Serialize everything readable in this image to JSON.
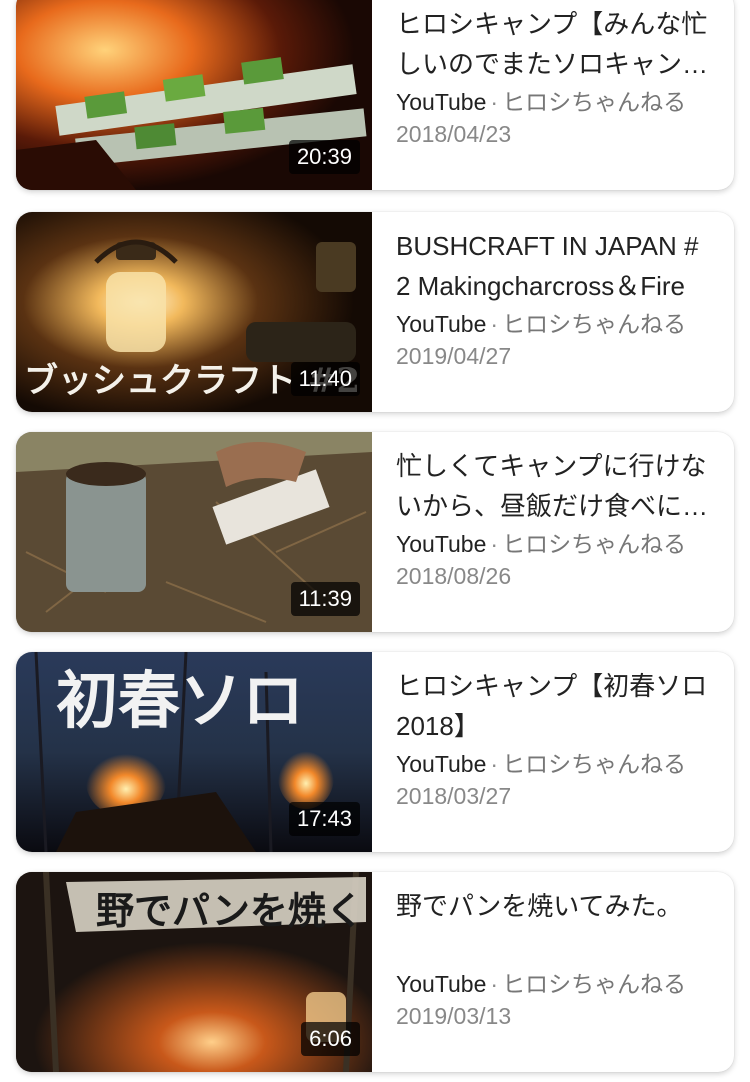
{
  "videos": [
    {
      "title": "ヒロシキャンプ【みんな忙しいのでまたソロキャンプ】",
      "duration": "20:39",
      "source": "YouTube",
      "separator": "·",
      "channel": "ヒロシちゃんねる",
      "date": "2018/04/23"
    },
    {
      "title": "BUSHCRAFT IN JAPAN #2 Makingcharcross＆Fire",
      "duration": "11:40",
      "thumb_text": "ブッシュクラフト #2",
      "source": "YouTube",
      "separator": "·",
      "channel": "ヒロシちゃんねる",
      "date": "2019/04/27"
    },
    {
      "title": "忙しくてキャンプに行けないから、昼飯だけ食べに行く",
      "duration": "11:39",
      "source": "YouTube",
      "separator": "·",
      "channel": "ヒロシちゃんねる",
      "date": "2018/08/26"
    },
    {
      "title": "ヒロシキャンプ【初春ソロ 2018】",
      "duration": "17:43",
      "thumb_text": "初春ソロ",
      "source": "YouTube",
      "separator": "·",
      "channel": "ヒロシちゃんねる",
      "date": "2018/03/27"
    },
    {
      "title": "野でパンを焼いてみた。",
      "duration": "6:06",
      "thumb_text": "野でパンを焼く",
      "source": "YouTube",
      "separator": "·",
      "channel": "ヒロシちゃんねる",
      "date": "2019/03/13"
    }
  ]
}
